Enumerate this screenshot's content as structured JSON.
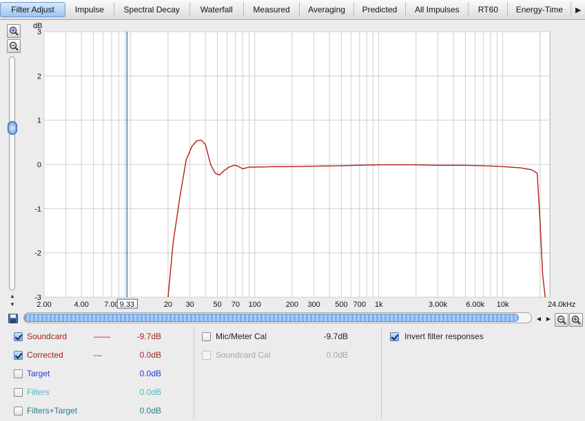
{
  "tabs": [
    {
      "label": "Filter Adjust",
      "active": true
    },
    {
      "label": "Impulse",
      "active": false
    },
    {
      "label": "Spectral Decay",
      "active": false
    },
    {
      "label": "Waterfall",
      "active": false
    },
    {
      "label": "Measured",
      "active": false
    },
    {
      "label": "Averaging",
      "active": false
    },
    {
      "label": "Predicted",
      "active": false
    },
    {
      "label": "All Impulses",
      "active": false
    },
    {
      "label": "RT60",
      "active": false
    },
    {
      "label": "Energy-Time",
      "active": false
    }
  ],
  "tab_more_icon": "triangle-right-icon",
  "chart_data": {
    "type": "line",
    "ylabel": "dB",
    "xlabel": "kHz",
    "ylim": [
      -3,
      3
    ],
    "y_ticks": [
      "3",
      "2",
      "1",
      "0",
      "-1",
      "-2",
      "-3"
    ],
    "x_scale": "log",
    "xlim": [
      2,
      24000
    ],
    "x_ticks": [
      {
        "value": 2,
        "label": "2.00"
      },
      {
        "value": 4,
        "label": "4.00"
      },
      {
        "value": 7,
        "label": "7.00"
      },
      {
        "value": 20,
        "label": "20"
      },
      {
        "value": 30,
        "label": "30"
      },
      {
        "value": 50,
        "label": "50"
      },
      {
        "value": 70,
        "label": "70"
      },
      {
        "value": 100,
        "label": "100"
      },
      {
        "value": 200,
        "label": "200"
      },
      {
        "value": 300,
        "label": "300"
      },
      {
        "value": 500,
        "label": "500"
      },
      {
        "value": 700,
        "label": "700"
      },
      {
        "value": 1000,
        "label": "1k"
      },
      {
        "value": 3000,
        "label": "3.00k"
      },
      {
        "value": 6000,
        "label": "6.00k"
      },
      {
        "value": 10000,
        "label": "10k"
      },
      {
        "value": 24000,
        "label": "24.0kHz"
      }
    ],
    "cursor": {
      "value": 9.33,
      "label": "9.33"
    },
    "grid": true,
    "series": [
      {
        "name": "Soundcard",
        "color": "#b2201c",
        "style": "solid",
        "x": [
          20,
          22,
          25,
          28,
          31,
          34,
          37,
          40,
          44,
          48,
          52,
          56,
          62,
          68,
          72,
          80,
          90,
          100,
          150,
          200,
          300,
          500,
          1000,
          2000,
          3000,
          5000,
          7000,
          10000,
          14000,
          17000,
          19000,
          20000,
          21000,
          22000
        ],
        "y": [
          -3,
          -1.75,
          -0.7,
          0.1,
          0.4,
          0.53,
          0.55,
          0.45,
          0.0,
          -0.2,
          -0.24,
          -0.15,
          -0.06,
          -0.02,
          -0.03,
          -0.1,
          -0.06,
          -0.06,
          -0.05,
          -0.05,
          -0.04,
          -0.03,
          -0.01,
          -0.01,
          -0.02,
          -0.02,
          -0.03,
          -0.05,
          -0.08,
          -0.12,
          -0.2,
          -1.3,
          -2.5,
          -3
        ]
      },
      {
        "name": "Corrected",
        "color": "#b2201c",
        "style": "dashed",
        "x": [
          20,
          22,
          25,
          28,
          31,
          34,
          37,
          40,
          44,
          48,
          52,
          56,
          62,
          68,
          72,
          80,
          90,
          100,
          150,
          200,
          300,
          500,
          1000,
          2000,
          3000,
          5000,
          7000,
          10000,
          14000,
          17000,
          19000,
          20000,
          21000,
          22000
        ],
        "y": [
          -3,
          -1.75,
          -0.7,
          0.1,
          0.4,
          0.53,
          0.55,
          0.45,
          0.0,
          -0.2,
          -0.24,
          -0.15,
          -0.06,
          -0.02,
          -0.03,
          -0.1,
          -0.06,
          -0.06,
          -0.05,
          -0.05,
          -0.04,
          -0.03,
          -0.01,
          -0.01,
          -0.02,
          -0.02,
          -0.03,
          -0.05,
          -0.08,
          -0.12,
          -0.2,
          -1.3,
          -2.5,
          -3
        ]
      }
    ]
  },
  "legend": {
    "col1": [
      {
        "name": "Soundcard",
        "checked": true,
        "color": "#a3221e",
        "line": "——",
        "value": "-9.7dB",
        "value_color": "#a3221e"
      },
      {
        "name": "Corrected",
        "checked": true,
        "color": "#a3221e",
        "line": "---",
        "value": "0.0dB",
        "value_color": "#a3221e"
      },
      {
        "name": "Target",
        "checked": false,
        "color": "#1f3fc6",
        "line": "",
        "value": "0.0dB",
        "value_color": "#1f3fc6"
      },
      {
        "name": "Filters",
        "checked": false,
        "color": "#4fb6c8",
        "line": "",
        "value": "0.0dB",
        "value_color": "#4fb6c8"
      },
      {
        "name": "Filters+Target",
        "checked": false,
        "color": "#2a7a86",
        "line": "",
        "value": "0.0dB",
        "value_color": "#2a7a86"
      }
    ],
    "col2": [
      {
        "name": "Mic/Meter Cal",
        "checked": false,
        "disabled": false,
        "value": "-9.7dB"
      },
      {
        "name": "Soundcard Cal",
        "checked": false,
        "disabled": true,
        "value": "0.0dB"
      }
    ],
    "col3": [
      {
        "name": "Invert filter responses",
        "checked": true
      }
    ]
  },
  "icons": {
    "zoom_in": "zoom-in-icon",
    "zoom_out": "zoom-out-icon",
    "save": "save-icon"
  }
}
